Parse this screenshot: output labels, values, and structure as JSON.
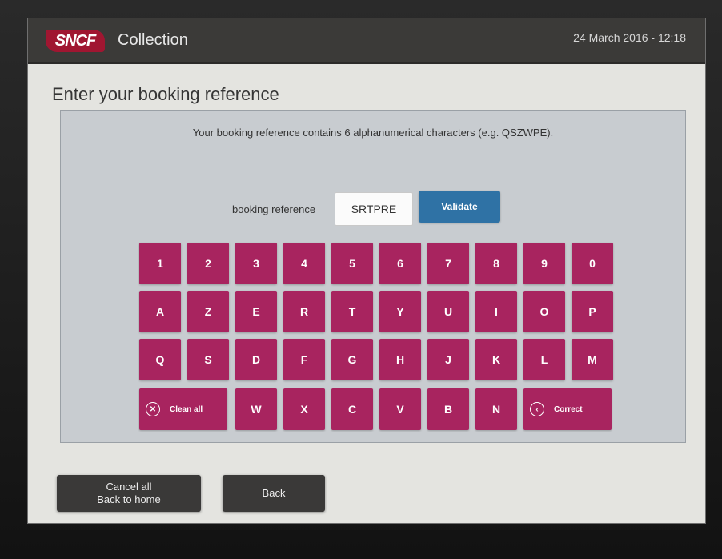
{
  "header": {
    "logo_text": "SNCF",
    "app_title": "Collection",
    "datetime": "24 March 2016 - 12:18"
  },
  "page": {
    "title": "Enter your booking reference",
    "hint": "Your booking reference contains 6 alphanumerical characters (e.g. QSZWPE)."
  },
  "form": {
    "label": "booking reference",
    "value": "SRTPRE",
    "validate_label": "Validate"
  },
  "keyboard": {
    "row1": [
      "1",
      "2",
      "3",
      "4",
      "5",
      "6",
      "7",
      "8",
      "9",
      "0"
    ],
    "row2": [
      "A",
      "Z",
      "E",
      "R",
      "T",
      "Y",
      "U",
      "I",
      "O",
      "P"
    ],
    "row3": [
      "Q",
      "S",
      "D",
      "F",
      "G",
      "H",
      "J",
      "K",
      "L",
      "M"
    ],
    "row4": [
      "W",
      "X",
      "C",
      "V",
      "B",
      "N"
    ],
    "clear_label": "Clean all",
    "correct_label": "Correct",
    "clear_icon": "x-circle-icon",
    "correct_icon": "left-chevron-circle-icon"
  },
  "footer": {
    "cancel_line1": "Cancel all",
    "cancel_line2": "Back to home",
    "back_label": "Back"
  },
  "colors": {
    "brand": "#a01631",
    "key": "#a8245f",
    "validate": "#2f72a5"
  }
}
